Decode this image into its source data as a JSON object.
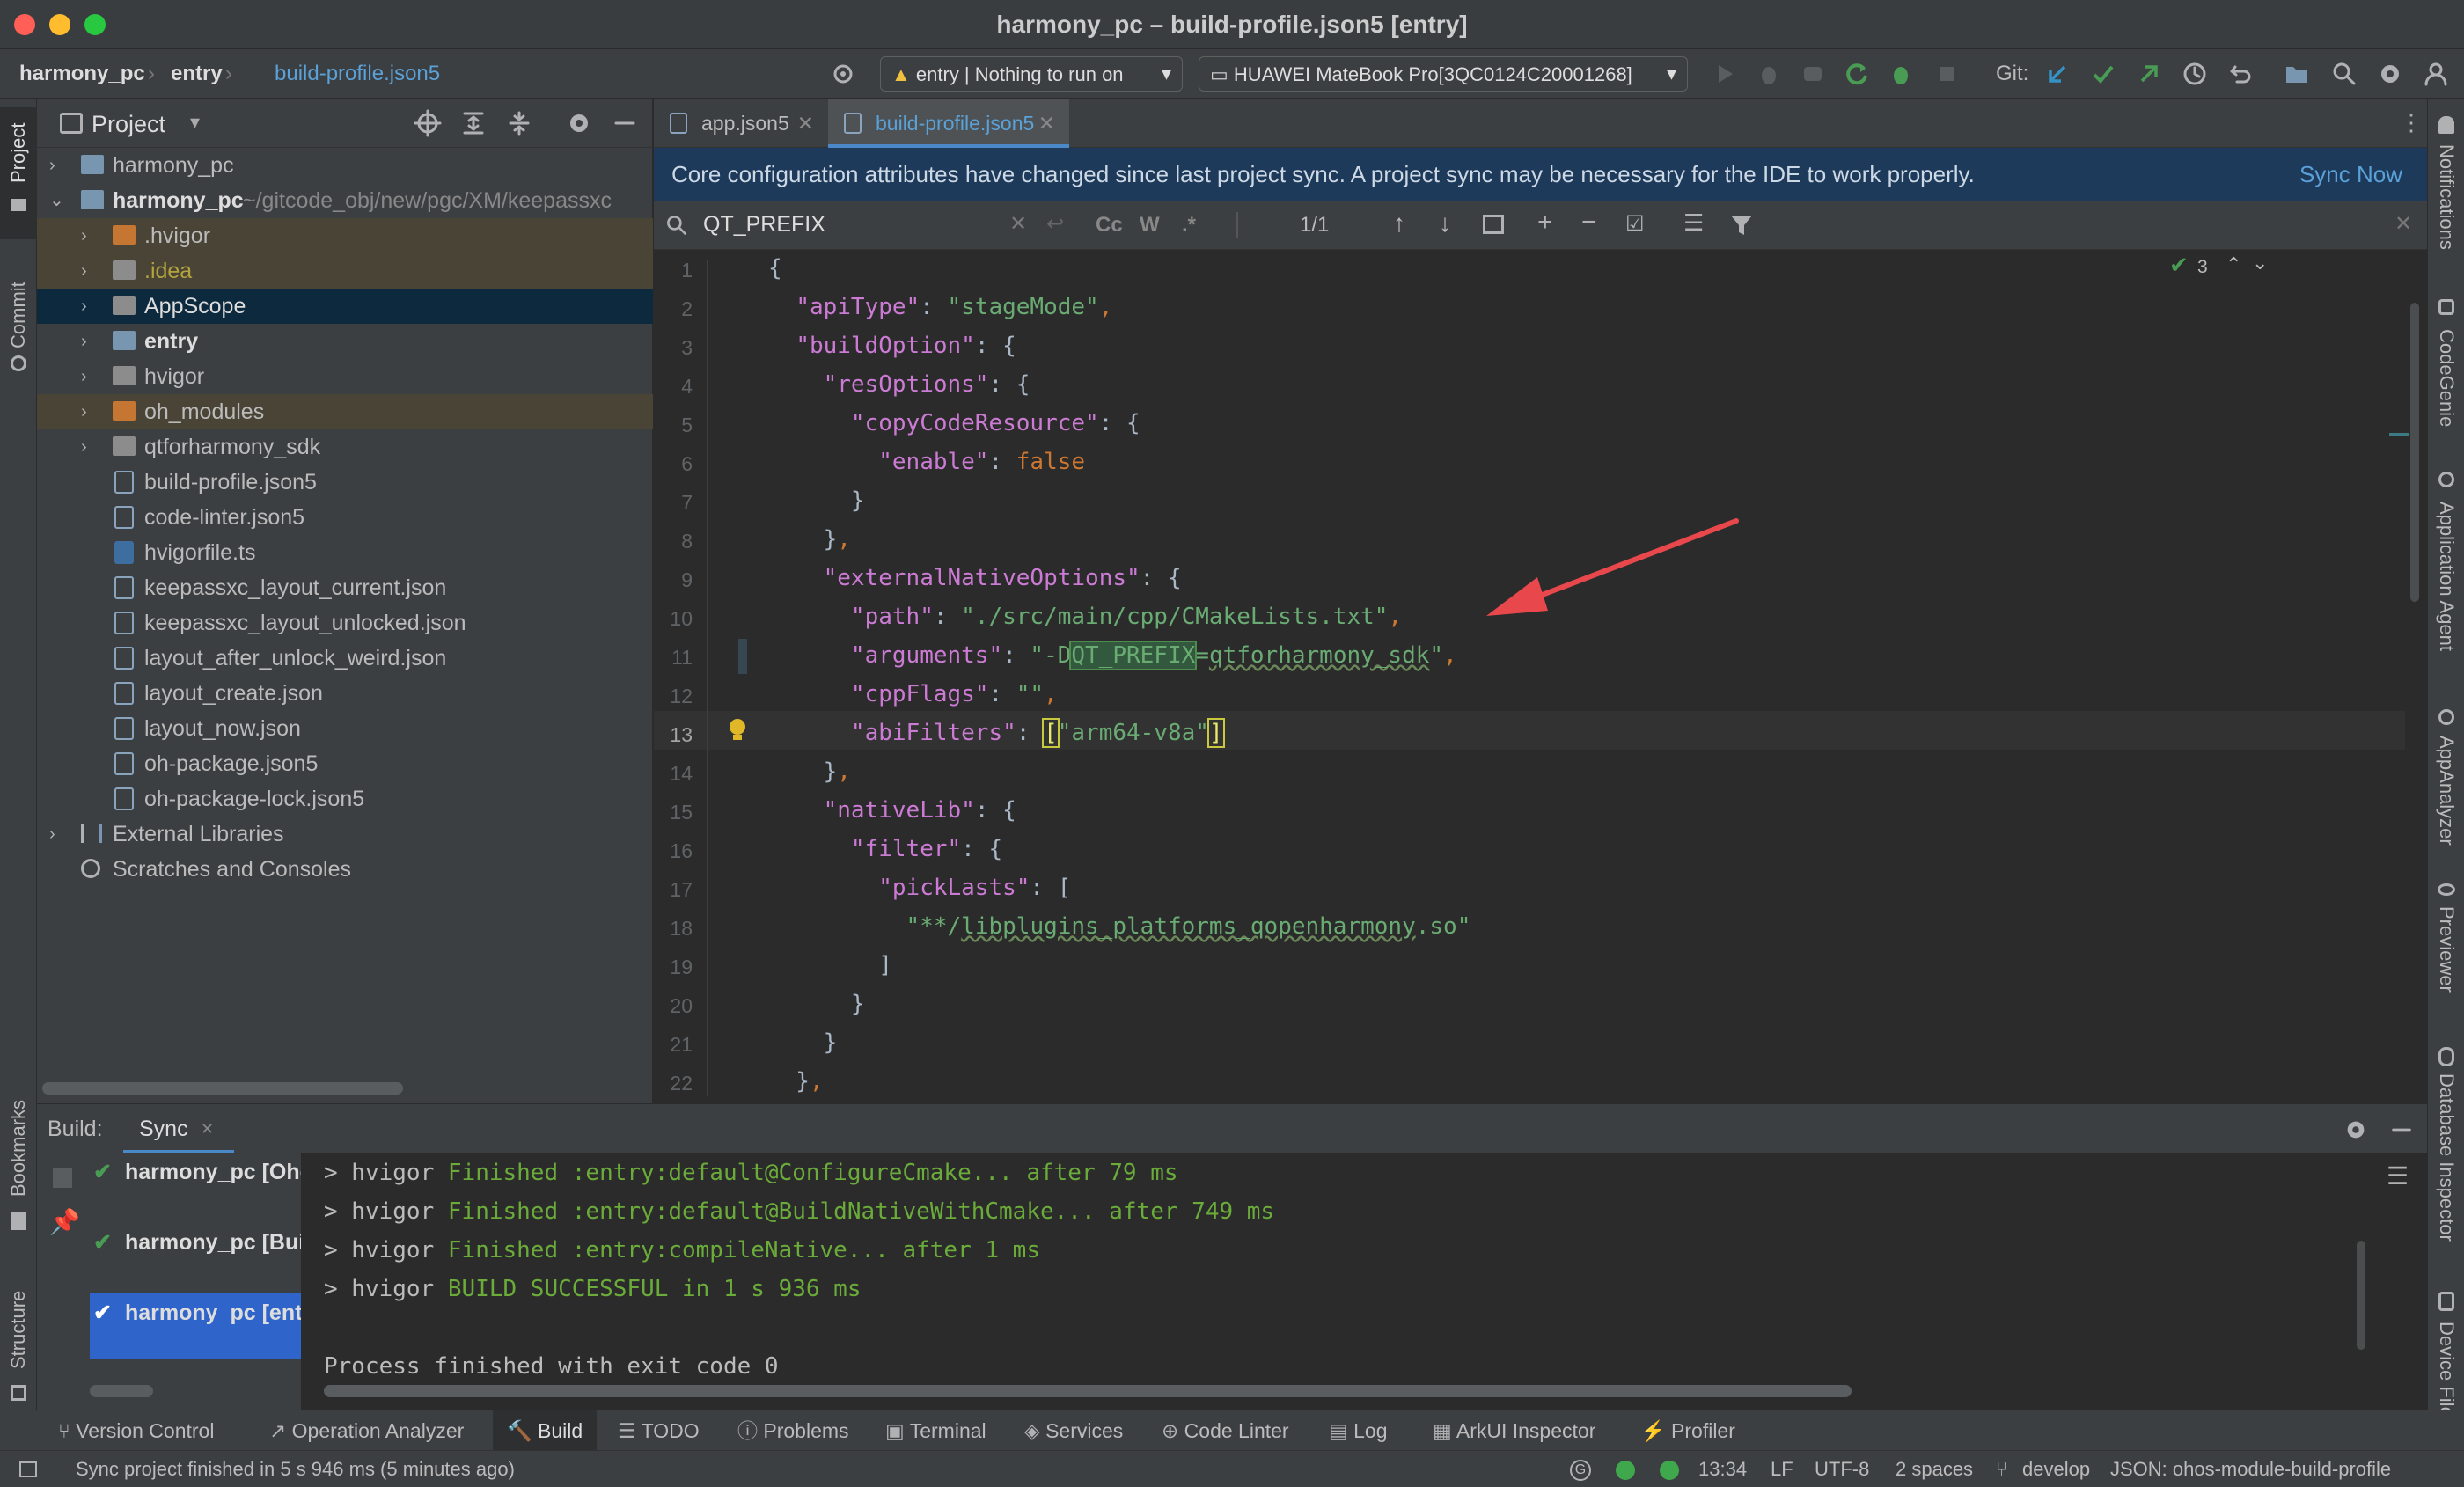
{
  "window": {
    "title": "harmony_pc – build-profile.json5 [entry]"
  },
  "nav": {
    "crumbs": [
      "harmony_pc",
      "entry",
      "build-profile.json5"
    ],
    "run_config": "entry | Nothing to run on",
    "device": "HUAWEI MateBook Pro[3QC0124C20001268]",
    "git_label": "Git:"
  },
  "left_strip": {
    "project": "Project",
    "commit": "Commit",
    "bookmarks": "Bookmarks",
    "structure": "Structure"
  },
  "right_strip": [
    "Notifications",
    "CodeGenie",
    "Application Agent",
    "AppAnalyzer",
    "Previewer",
    "Database Inspector",
    "Device File"
  ],
  "project": {
    "header": "Project",
    "tree": [
      {
        "label": "harmony_pc",
        "bold": false,
        "level": 0
      },
      {
        "label": "harmony_pc",
        "suffix": "~/gitcode_obj/new/pgc/XM/keepassxc",
        "bold": true,
        "level": 0
      },
      {
        "label": ".hvigor",
        "level": 1
      },
      {
        "label": ".idea",
        "level": 1
      },
      {
        "label": "AppScope",
        "level": 1
      },
      {
        "label": "entry",
        "level": 1
      },
      {
        "label": "hvigor",
        "level": 1
      },
      {
        "label": "oh_modules",
        "level": 1
      },
      {
        "label": "qtforharmony_sdk",
        "level": 1
      },
      {
        "label": "build-profile.json5",
        "level": 1
      },
      {
        "label": "code-linter.json5",
        "level": 1
      },
      {
        "label": "hvigorfile.ts",
        "level": 1
      },
      {
        "label": "keepassxc_layout_current.json",
        "level": 1
      },
      {
        "label": "keepassxc_layout_unlocked.json",
        "level": 1
      },
      {
        "label": "layout_after_unlock_weird.json",
        "level": 1
      },
      {
        "label": "layout_create.json",
        "level": 1
      },
      {
        "label": "layout_now.json",
        "level": 1
      },
      {
        "label": "oh-package.json5",
        "level": 1
      },
      {
        "label": "oh-package-lock.json5",
        "level": 1
      },
      {
        "label": "External Libraries",
        "level": 0
      },
      {
        "label": "Scratches and Consoles",
        "level": 0
      }
    ]
  },
  "editor": {
    "tabs": [
      "app.json5",
      "build-profile.json5"
    ],
    "banner": "Core configuration attributes have changed since last project sync. A project sync may be necessary for the IDE to work properly.",
    "banner_action": "Sync Now",
    "search": {
      "value": "QT_PREFIX",
      "count": "1/1",
      "opt_case": "Cc",
      "opt_word": "W",
      "opt_regex": ".*"
    },
    "inspection_count": "3",
    "line_numbers": [
      "1",
      "2",
      "3",
      "4",
      "5",
      "6",
      "7",
      "8",
      "9",
      "10",
      "11",
      "12",
      "13",
      "14",
      "15",
      "16",
      "17",
      "18",
      "19",
      "20",
      "21",
      "22"
    ]
  },
  "build": {
    "label": "Build:",
    "tab": "Sync",
    "items": [
      "harmony_pc [OhosSync]",
      "harmony_pc [Build]",
      "harmony_pc [entry]"
    ],
    "output": [
      {
        "prefix": "> hvigor ",
        "text": "Finished :entry:default@ConfigureCmake... after 79 ms"
      },
      {
        "prefix": "> hvigor ",
        "text": "Finished :entry:default@BuildNativeWithCmake... after 749 ms"
      },
      {
        "prefix": "> hvigor ",
        "text": "Finished :entry:compileNative... after 1 ms"
      },
      {
        "prefix": "> hvigor ",
        "text": "BUILD SUCCESSFUL in 1 s 936 ms"
      },
      {
        "prefix": "",
        "text": ""
      },
      {
        "prefix": "",
        "text": "Process finished with exit code 0"
      }
    ]
  },
  "tools": [
    "Version Control",
    "Operation Analyzer",
    "Build",
    "TODO",
    "Problems",
    "Terminal",
    "Services",
    "Code Linter",
    "Log",
    "ArkUI Inspector",
    "Profiler"
  ],
  "status": {
    "message": "Sync project finished in 5 s 946 ms (5 minutes ago)",
    "time": "13:34",
    "line_sep": "LF",
    "encoding": "UTF-8",
    "indent": "2 spaces",
    "branch": "develop",
    "schema": "JSON: ohos-module-build-profile"
  },
  "colors": {
    "accent": "#3592c4",
    "success": "#499c54",
    "arrow": "#e8484b",
    "selection": "#0d293e"
  }
}
